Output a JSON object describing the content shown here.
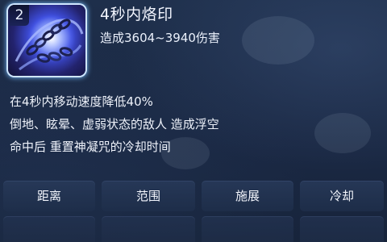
{
  "skill": {
    "level": "2",
    "name": "4秒内烙印",
    "damage": "造成3604~3940伤害"
  },
  "description": {
    "lines": [
      "在4秒内移动速度降低40%",
      "倒地、眩晕、虚弱状态的敌人 造成浮空",
      "命中后 重置神凝咒的冷却时间"
    ]
  },
  "stats": {
    "headers": [
      "距离",
      "范围",
      "施展",
      "冷却"
    ]
  },
  "colors": {
    "background": "#1b2a44",
    "icon_glow": "#78beff"
  },
  "icons": {
    "skill": "chain-whirl-skill-icon"
  }
}
